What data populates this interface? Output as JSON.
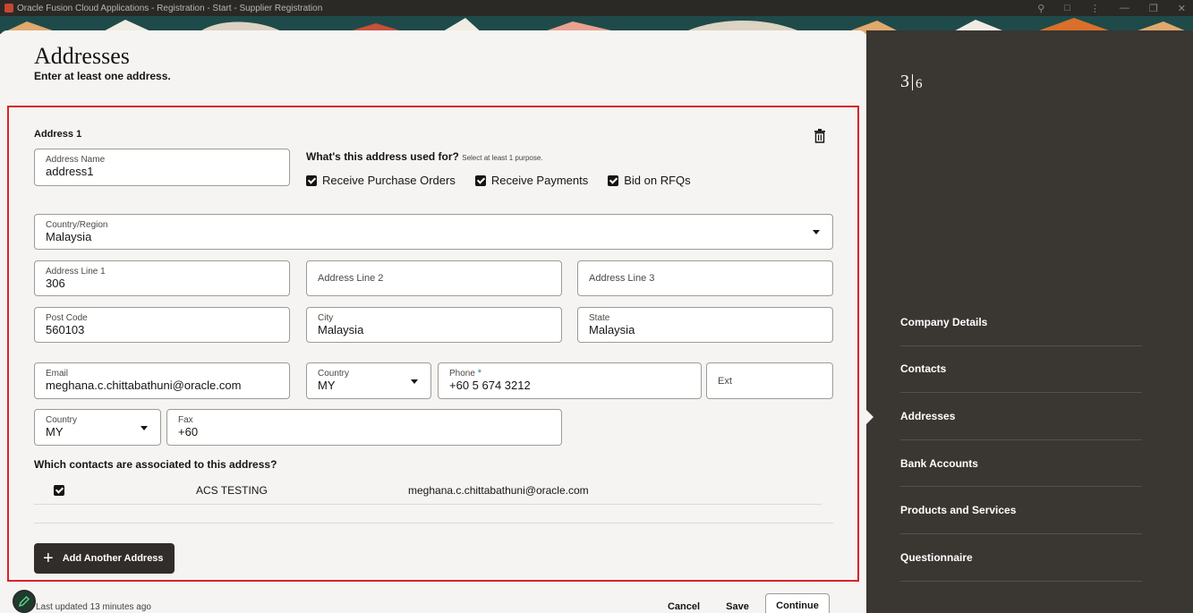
{
  "window": {
    "title": "Oracle Fusion Cloud Applications - Registration - Start - Supplier Registration"
  },
  "page": {
    "title": "Addresses",
    "subtitle": "Enter at least one address."
  },
  "address": {
    "heading": "Address 1",
    "name": {
      "label": "Address Name",
      "value": "address1"
    },
    "purpose": {
      "question": "What's this address used for?",
      "hint": "Select at least 1 purpose.",
      "options": [
        {
          "label": "Receive Purchase Orders",
          "checked": true
        },
        {
          "label": "Receive Payments",
          "checked": true
        },
        {
          "label": "Bid on RFQs",
          "checked": true
        }
      ]
    },
    "country": {
      "label": "Country/Region",
      "value": "Malaysia"
    },
    "line1": {
      "label": "Address Line 1",
      "value": "306"
    },
    "line2": {
      "placeholder": "Address Line 2"
    },
    "line3": {
      "placeholder": "Address Line 3"
    },
    "postcode": {
      "label": "Post Code",
      "value": "560103"
    },
    "city": {
      "label": "City",
      "value": "Malaysia"
    },
    "state": {
      "label": "State",
      "value": "Malaysia"
    },
    "email": {
      "label": "Email",
      "value": "meghana.c.chittabathuni@oracle.com"
    },
    "phone_country": {
      "label": "Country",
      "value": "MY"
    },
    "phone": {
      "label": "Phone",
      "required_mark": "*",
      "value": "+60 5 674 3212"
    },
    "ext": {
      "placeholder": "Ext"
    },
    "fax_country": {
      "label": "Country",
      "value": "MY"
    },
    "fax": {
      "label": "Fax",
      "value": "+60"
    },
    "contacts_question": "Which contacts are associated to this address?",
    "contacts": [
      {
        "name": "ACS TESTING",
        "email": "meghana.c.chittabathuni@oracle.com",
        "checked": true
      }
    ],
    "add_button": "Add Another Address"
  },
  "footer": {
    "last_updated": "Last updated 13 minutes ago",
    "cancel": "Cancel",
    "save": "Save",
    "continue": "Continue"
  },
  "sidepanel": {
    "step_current": "3",
    "step_total": "6",
    "nav": [
      "Company Details",
      "Contacts",
      "Addresses",
      "Bank Accounts",
      "Products and Services",
      "Questionnaire"
    ],
    "active_index": 2
  },
  "colors": {
    "accent_red": "#d9232a",
    "panel_bg": "#3a3632",
    "button_dark": "#312d2a"
  }
}
